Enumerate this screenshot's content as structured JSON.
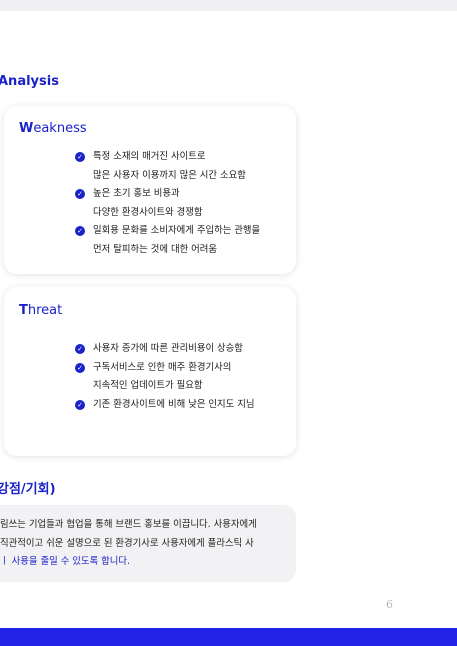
{
  "section_title": "Analysis",
  "weakness": {
    "title_first": "W",
    "title_rest": "eakness",
    "items": [
      {
        "lines": [
          "특정 소재의 매거진 사이트로",
          "많은 사용자 이용까지 많은 시간 소요함"
        ]
      },
      {
        "lines": [
          "높은 초기 홍보 비용과",
          "다양한 환경사이트와 경쟁함"
        ]
      },
      {
        "lines": [
          "일회용 문화를 소비자에게 주입하는 관행을",
          "먼저 탈피하는 것에 대한 어려움"
        ]
      }
    ]
  },
  "threat": {
    "title_first": "T",
    "title_rest": "hreat",
    "items": [
      {
        "lines": [
          "사용자 증가에 따른 관리비용이 상승함"
        ]
      },
      {
        "lines": [
          "구독서비스로 인한 매주 환경기사의",
          "지속적인 업데이트가 필요함"
        ]
      },
      {
        "lines": [
          "기존 환경사이트에 비해 낮은 인지도 지님"
        ]
      }
    ]
  },
  "sub_heading": "강점/기회)",
  "summary": {
    "line1": "림쓰는 기업들과 협업을 통해 브랜드 홍보를 이끕니다. 사용자에게",
    "line2": "직관적이고 쉬운 설명으로 된 환경기사로 사용자에게  플라스틱 사",
    "line3": "ㅣ 사용을 줄일 수 있도록 합니다."
  },
  "page_number": "6",
  "colors": {
    "accent": "#1a22c9",
    "bar": "#2222e6"
  }
}
